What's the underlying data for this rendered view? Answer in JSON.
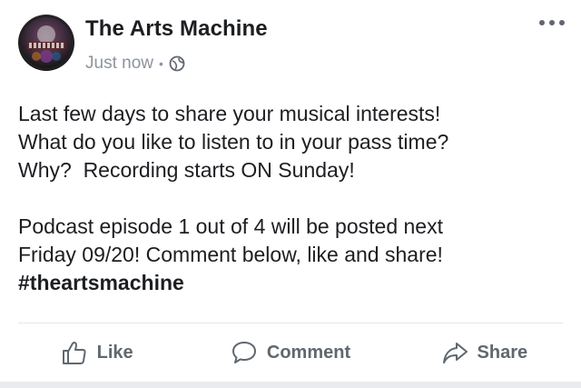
{
  "post": {
    "page_name": "The Arts Machine",
    "timestamp": "Just now",
    "separator": "•",
    "privacy_icon": "globe-icon",
    "more_icon": "more-options-icon",
    "text_lines": [
      "Last few days to share your musical interests!",
      "What do you like to listen to in your pass time?",
      "Why?  Recording starts ON Sunday!",
      "Podcast episode 1 out of 4 will be posted next",
      "Friday 09/20! Comment below, like and share!"
    ],
    "hashtag": "#theartsmachine"
  },
  "actions": {
    "like": {
      "label": "Like",
      "icon": "thumbs-up-icon"
    },
    "comment": {
      "label": "Comment",
      "icon": "speech-bubble-icon"
    },
    "share": {
      "label": "Share",
      "icon": "share-arrow-icon"
    }
  },
  "colors": {
    "primary_text": "#1c1e21",
    "secondary_text": "#8d949e",
    "action_text": "#606770",
    "divider": "#e4e6eb"
  }
}
